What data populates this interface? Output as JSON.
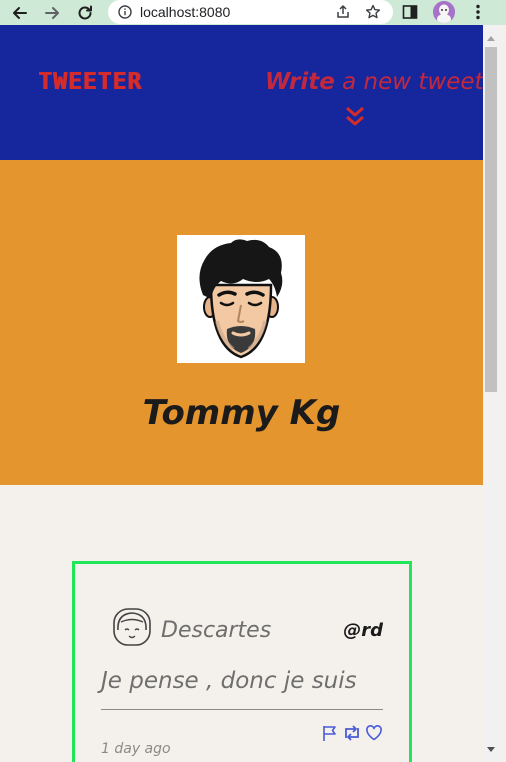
{
  "browser": {
    "url": "localhost:8080"
  },
  "nav": {
    "brand": "TWEETER",
    "compose_strong": "Write",
    "compose_rest": " a new tweet"
  },
  "profile": {
    "name": "Tommy Kg"
  },
  "tweets": [
    {
      "author": "Descartes",
      "handle": "@rd",
      "content": "Je pense , donc je suis",
      "time": "1 day ago"
    }
  ],
  "colors": {
    "nav_bg": "#16279d",
    "brand": "#d52b2b",
    "profile_bg": "#e4952e",
    "page_bg": "#f4f1ec",
    "card_border": "#22e65a",
    "action_icons": "#4a5bd6"
  }
}
